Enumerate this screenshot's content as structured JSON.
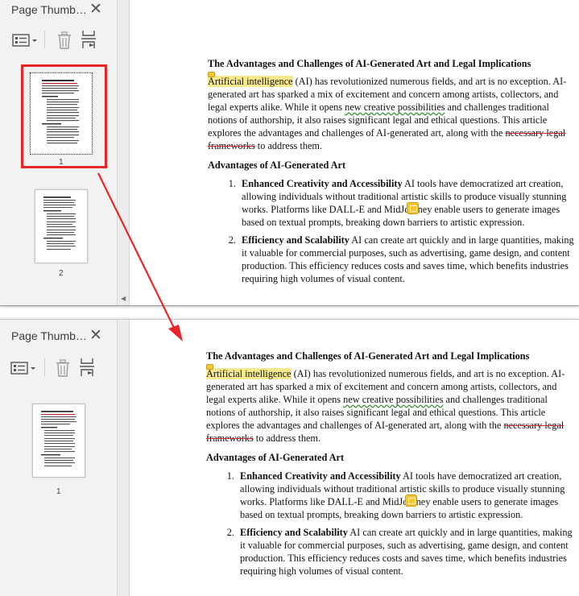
{
  "sidebar_top": {
    "title": "Page Thumb…",
    "pages": [
      "1",
      "2"
    ]
  },
  "sidebar_bottom": {
    "title": "Page Thumb…",
    "pages": [
      "1"
    ]
  },
  "icons": {
    "close": "close-icon",
    "options": "thumbnail-options-icon",
    "delete": "trash-icon",
    "insert": "insert-page-icon"
  },
  "document": {
    "title": "The Advantages and Challenges of AI-Generated Art and Legal Implications",
    "intro": {
      "highlighted": "Artificial intelligence",
      "part1": " (AI) has revolutionized numerous fields, and art is no exception. AI-generated art has sparked a mix of excitement and concern among artists, collectors, and legal experts alike. While it opens ",
      "underlined": "new creative possibilities",
      "part2": " and challenges traditional notions of authorship, it also raises significant legal and ethical questions. This article explores the advantages and challenges of AI-generated art, along with the ",
      "struck": "necessary legal frameworks",
      "part3": " to address them."
    },
    "section_heading": "Advantages of AI-Generated Art",
    "items": [
      {
        "number": "1.",
        "bold": "Enhanced Creativity and Accessibility",
        "text": " AI tools have democratized art creation, allowing individuals without traditional artistic skills to produce visually stunning works. Platforms like DALL-E and MidJourney enable users to generate images based on textual prompts, breaking down barriers to artistic expression."
      },
      {
        "number": "2.",
        "bold": "Efficiency and Scalability",
        "text": " AI can create art quickly and in large quantities, making it valuable for commercial purposes, such as advertising, game design, and content production. This efficiency reduces costs and saves time, which benefits industries requiring high volumes of visual content."
      }
    ]
  },
  "colors": {
    "selection_border": "#e8262a",
    "arrow": "#e8262a",
    "highlight": "#f7e98d",
    "note": "#f7c531",
    "strike": "#c2262e"
  }
}
